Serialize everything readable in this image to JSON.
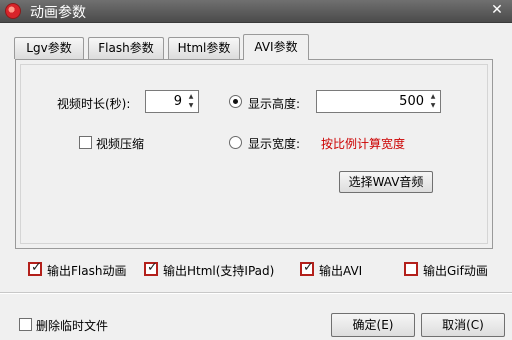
{
  "window": {
    "title": "动画参数",
    "close": "✕"
  },
  "tabs": [
    {
      "label": "Lgv参数"
    },
    {
      "label": "Flash参数"
    },
    {
      "label": "Html参数"
    },
    {
      "label": "AVI参数"
    }
  ],
  "avi": {
    "duration_label": "视频时长(秒):",
    "duration_value": "9",
    "compress_label": "视频压缩",
    "compress_checked": false,
    "height_label": "显示高度:",
    "height_value": "500",
    "height_selected": true,
    "width_label": "显示宽度:",
    "width_hint": "按比例计算宽度",
    "width_selected": false,
    "wav_button": "选择WAV音频"
  },
  "outputs": [
    {
      "label": "输出Flash动画",
      "checked": true
    },
    {
      "label": "输出Html(支持IPad)",
      "checked": true
    },
    {
      "label": "输出AVI",
      "checked": true
    },
    {
      "label": "输出Gif动画",
      "checked": false
    }
  ],
  "footer": {
    "delete_temp_label": "删除临时文件",
    "delete_temp_checked": false,
    "ok_button": "确定(E)",
    "cancel_button": "取消(C)"
  },
  "colors": {
    "accent_red": "#b3201b",
    "hint_red": "#cc0000"
  }
}
